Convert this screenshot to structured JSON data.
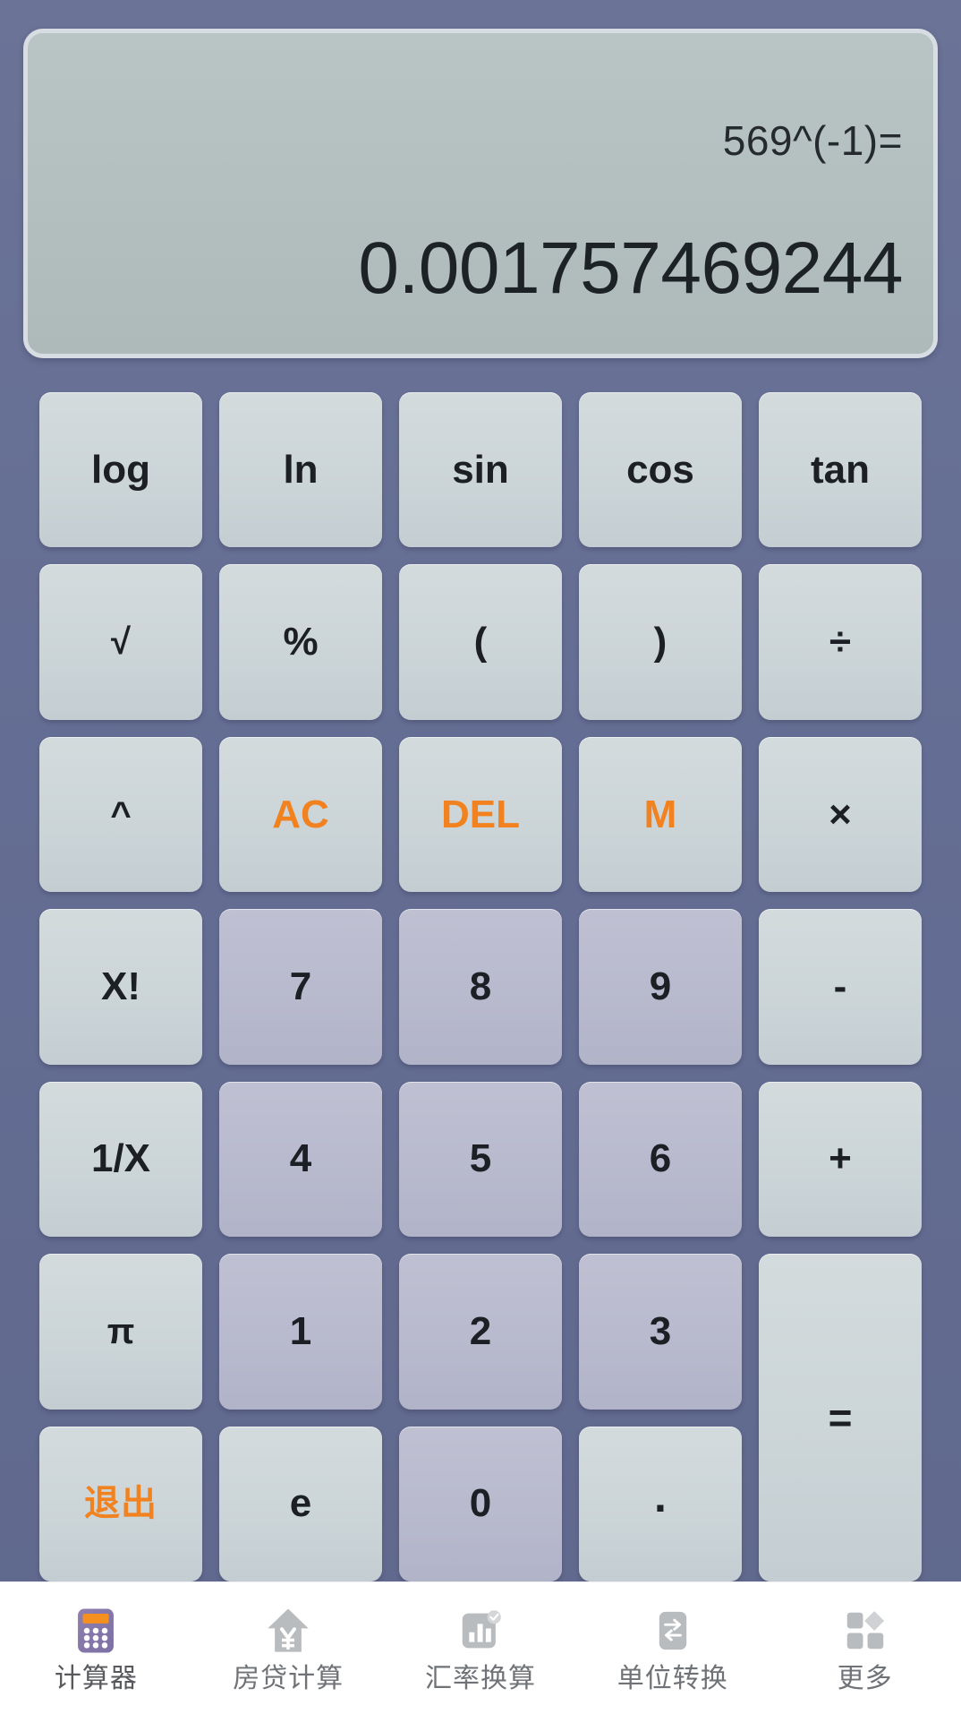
{
  "display": {
    "expression": "569^(-1)=",
    "result": "0.001757469244"
  },
  "colors": {
    "background": "#646d93",
    "display_panel": "#b4c0c0",
    "function_key": "#ccd5d8",
    "number_key": "#b8b9cd",
    "accent_orange": "#f1821f",
    "key_text": "#1c2025",
    "tabbar_background": "#ffffff",
    "tab_label": "#6f7276"
  },
  "keypad": {
    "rows": [
      [
        {
          "label": "log",
          "type": "fn",
          "name": "key-log"
        },
        {
          "label": "ln",
          "type": "fn",
          "name": "key-ln"
        },
        {
          "label": "sin",
          "type": "fn",
          "name": "key-sin"
        },
        {
          "label": "cos",
          "type": "fn",
          "name": "key-cos"
        },
        {
          "label": "tan",
          "type": "fn",
          "name": "key-tan"
        }
      ],
      [
        {
          "label": "√",
          "type": "fn",
          "name": "key-sqrt"
        },
        {
          "label": "%",
          "type": "fn",
          "name": "key-percent"
        },
        {
          "label": "(",
          "type": "fn",
          "name": "key-open-paren"
        },
        {
          "label": ")",
          "type": "fn",
          "name": "key-close-paren"
        },
        {
          "label": "÷",
          "type": "fn",
          "name": "key-divide"
        }
      ],
      [
        {
          "label": "^",
          "type": "fn",
          "name": "key-power"
        },
        {
          "label": "AC",
          "type": "accent",
          "name": "key-all-clear"
        },
        {
          "label": "DEL",
          "type": "accent",
          "name": "key-delete"
        },
        {
          "label": "M",
          "type": "accent",
          "name": "key-memory"
        },
        {
          "label": "×",
          "type": "fn",
          "name": "key-multiply"
        }
      ],
      [
        {
          "label": "X!",
          "type": "fn",
          "name": "key-factorial"
        },
        {
          "label": "7",
          "type": "num",
          "name": "key-7"
        },
        {
          "label": "8",
          "type": "num",
          "name": "key-8"
        },
        {
          "label": "9",
          "type": "num",
          "name": "key-9"
        },
        {
          "label": "-",
          "type": "fn",
          "name": "key-minus"
        }
      ],
      [
        {
          "label": "1/X",
          "type": "fn",
          "name": "key-reciprocal"
        },
        {
          "label": "4",
          "type": "num",
          "name": "key-4"
        },
        {
          "label": "5",
          "type": "num",
          "name": "key-5"
        },
        {
          "label": "6",
          "type": "num",
          "name": "key-6"
        },
        {
          "label": "+",
          "type": "fn",
          "name": "key-plus"
        }
      ],
      [
        {
          "label": "π",
          "type": "fn",
          "name": "key-pi"
        },
        {
          "label": "1",
          "type": "num",
          "name": "key-1"
        },
        {
          "label": "2",
          "type": "num",
          "name": "key-2"
        },
        {
          "label": "3",
          "type": "num",
          "name": "key-3"
        },
        {
          "label": "=",
          "type": "equals",
          "name": "key-equals"
        }
      ],
      [
        {
          "label": "退出",
          "type": "cjk-accent",
          "name": "key-exit"
        },
        {
          "label": "e",
          "type": "fn",
          "name": "key-e"
        },
        {
          "label": "0",
          "type": "num",
          "name": "key-0"
        },
        {
          "label": ".",
          "type": "fn",
          "name": "key-decimal"
        }
      ]
    ]
  },
  "tabbar": {
    "items": [
      {
        "label": "计算器",
        "icon": "calculator-icon",
        "name": "tab-calculator",
        "active": true
      },
      {
        "label": "房贷计算",
        "icon": "house-yuan-icon",
        "name": "tab-mortgage",
        "active": false
      },
      {
        "label": "汇率换算",
        "icon": "bar-chart-icon",
        "name": "tab-exchange-rate",
        "active": false
      },
      {
        "label": "单位转换",
        "icon": "swap-arrows-icon",
        "name": "tab-unit-convert",
        "active": false
      },
      {
        "label": "更多",
        "icon": "grid-more-icon",
        "name": "tab-more",
        "active": false
      }
    ]
  }
}
